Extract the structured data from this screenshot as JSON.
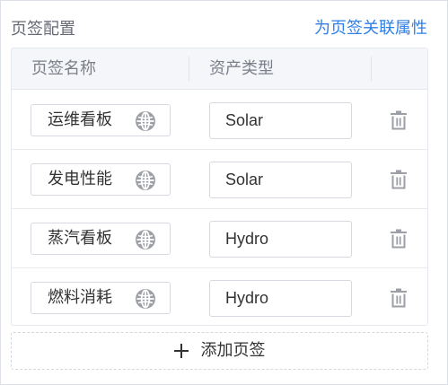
{
  "header": {
    "title": "页签配置",
    "link_label": "为页签关联属性"
  },
  "table": {
    "columns": [
      "页签名称",
      "资产类型"
    ],
    "rows": [
      {
        "name": "运维看板",
        "asset_type": "Solar"
      },
      {
        "name": "发电性能",
        "asset_type": "Solar"
      },
      {
        "name": "蒸汽看板",
        "asset_type": "Hydro"
      },
      {
        "name": "燃料消耗",
        "asset_type": "Hydro"
      }
    ]
  },
  "add_button": {
    "label": "添加页签",
    "icon": "plus-icon"
  },
  "icons": {
    "row_locale": "globe-icon",
    "row_delete": "trash-icon"
  },
  "colors": {
    "link": "#2f7fe8",
    "icon_gray": "#9c9fa6",
    "header_bg": "#f5f6fa",
    "border": "#dcdfe6"
  }
}
